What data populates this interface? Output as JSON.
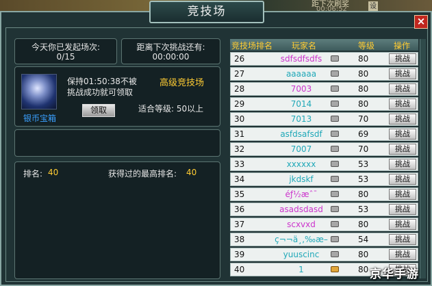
{
  "background_strip": {
    "text1": "距下次刷奖",
    "text2": "00:06:52",
    "text3": "设"
  },
  "window": {
    "title": "竞技场",
    "close_label": "×"
  },
  "challenges": {
    "label": "今天你已发起场次:",
    "value": "0/15"
  },
  "next_challenge": {
    "label": "距离下次挑战还有:",
    "value": "00:00:00"
  },
  "reward": {
    "desc_line1": "保持01:50:38不被",
    "desc_line2": "挑战成功就可领取",
    "arena_type": "高级竞技场",
    "item_name": "银币宝箱",
    "claim_label": "领取",
    "level_req": "适合等级: 50以上"
  },
  "stats": {
    "rank_label": "排名:",
    "rank_value": "40",
    "best_label": "获得过的最高排名:",
    "best_value": "40"
  },
  "ranking": {
    "headers": {
      "rank": "竞技场排名",
      "player": "玩家名",
      "level": "等级",
      "action": "操作"
    },
    "rows": [
      {
        "rank": "26",
        "name": "sdfsdfsdfs",
        "level": "80",
        "action": "挑战",
        "color": "#cc33cc"
      },
      {
        "rank": "27",
        "name": "aaaaaa",
        "level": "80",
        "action": "挑战",
        "color": "#1fa8b8"
      },
      {
        "rank": "28",
        "name": "7003",
        "level": "80",
        "action": "挑战",
        "color": "#cc33cc"
      },
      {
        "rank": "29",
        "name": "7014",
        "level": "80",
        "action": "挑战",
        "color": "#1fa8b8"
      },
      {
        "rank": "30",
        "name": "7013",
        "level": "70",
        "action": "挑战",
        "color": "#1fa8b8"
      },
      {
        "rank": "31",
        "name": "asfdsafsdf",
        "level": "69",
        "action": "挑战",
        "color": "#1fa8b8"
      },
      {
        "rank": "32",
        "name": "7007",
        "level": "70",
        "action": "挑战",
        "color": "#1fa8b8"
      },
      {
        "rank": "33",
        "name": "xxxxxx",
        "level": "53",
        "action": "挑战",
        "color": "#1fa8b8"
      },
      {
        "rank": "34",
        "name": "jkdskf",
        "level": "53",
        "action": "挑战",
        "color": "#1fa8b8"
      },
      {
        "rank": "35",
        "name": "éƒ½æˆ¯",
        "level": "80",
        "action": "挑战",
        "color": "#cc33cc"
      },
      {
        "rank": "36",
        "name": "asadsdasd",
        "level": "53",
        "action": "挑战",
        "color": "#cc33cc"
      },
      {
        "rank": "37",
        "name": "scxvxd",
        "level": "80",
        "action": "挑战",
        "color": "#cc33cc"
      },
      {
        "rank": "38",
        "name": "ç¬¬ä¸‚‰æ–",
        "level": "54",
        "action": "挑战",
        "color": "#1fa8b8"
      },
      {
        "rank": "39",
        "name": "yuuscinc",
        "level": "80",
        "action": "挑战",
        "color": "#1fa8b8"
      },
      {
        "rank": "40",
        "name": "1",
        "level": "80",
        "action": "挑战",
        "color": "#1fa8b8"
      }
    ]
  },
  "watermark": "京华手游"
}
